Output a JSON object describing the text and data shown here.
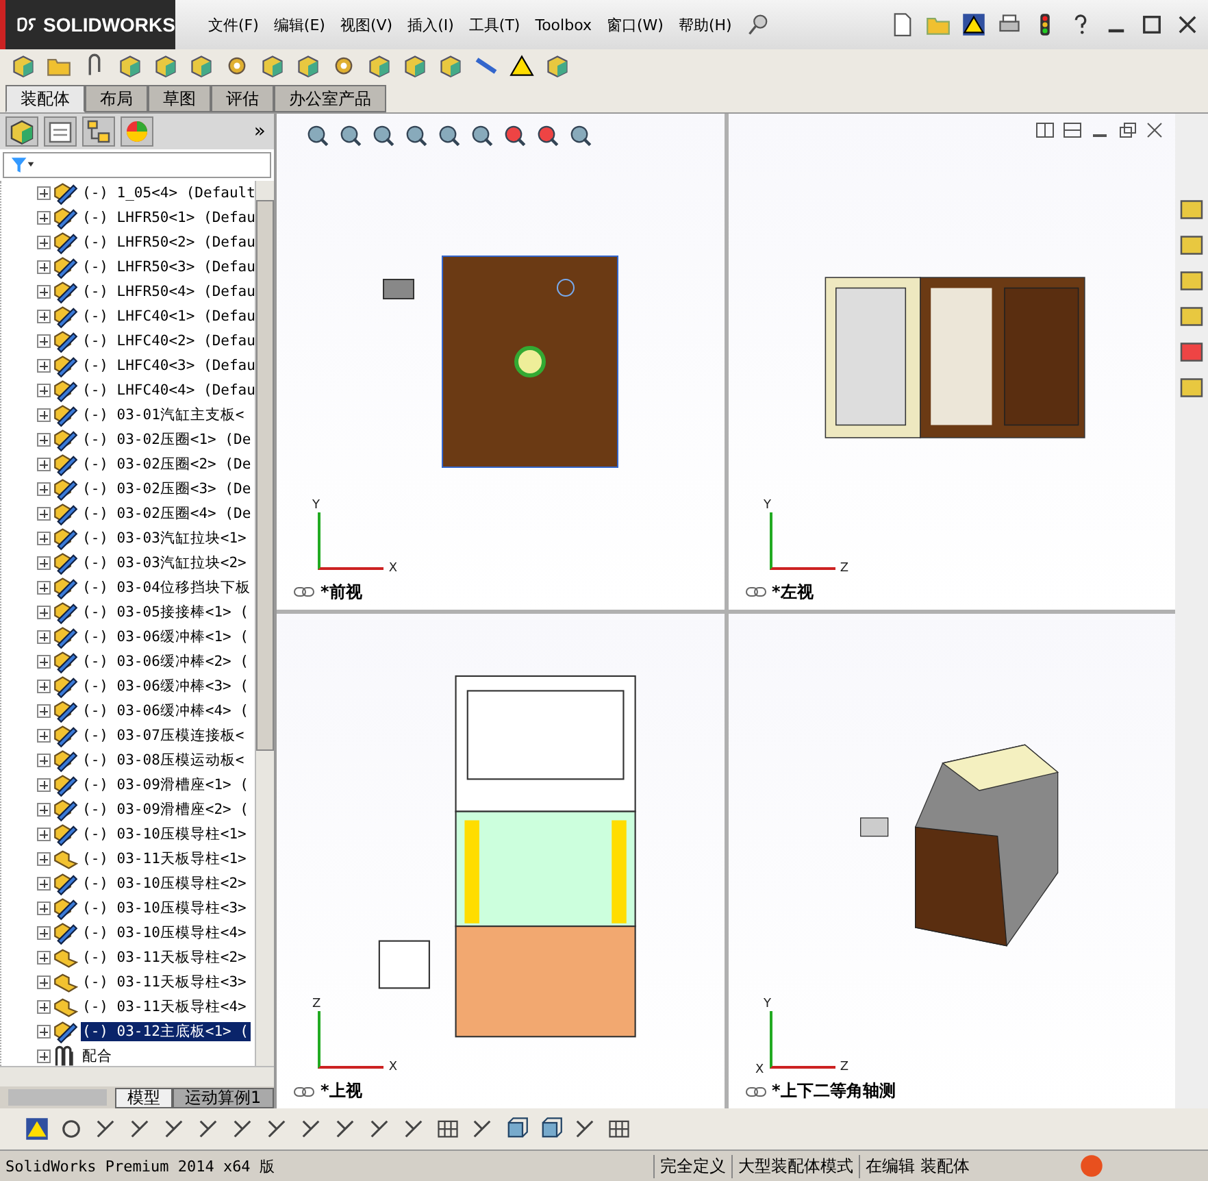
{
  "title_bar": {
    "logo": "SOLIDWORKS",
    "menu": [
      "文件(F)",
      "编辑(E)",
      "视图(V)",
      "插入(I)",
      "工具(T)",
      "Toolbox",
      "窗口(W)",
      "帮助(H)"
    ]
  },
  "command_tabs": [
    {
      "label": "装配体",
      "selected": true
    },
    {
      "label": "布局",
      "selected": false
    },
    {
      "label": "草图",
      "selected": false
    },
    {
      "label": "评估",
      "selected": false
    },
    {
      "label": "办公室产品",
      "selected": false
    }
  ],
  "panel": {
    "more": "»"
  },
  "tree": {
    "items": [
      {
        "kind": "part",
        "label": "(-) 1_05<4> (Default",
        "selected": false
      },
      {
        "kind": "part",
        "label": "(-) LHFR50<1> (Defau",
        "selected": false
      },
      {
        "kind": "part",
        "label": "(-) LHFR50<2> (Defau",
        "selected": false
      },
      {
        "kind": "part",
        "label": "(-) LHFR50<3> (Defau",
        "selected": false
      },
      {
        "kind": "part",
        "label": "(-) LHFR50<4> (Defau",
        "selected": false
      },
      {
        "kind": "part",
        "label": "(-) LHFC40<1> (Defau",
        "selected": false
      },
      {
        "kind": "part",
        "label": "(-) LHFC40<2> (Defau",
        "selected": false
      },
      {
        "kind": "part",
        "label": "(-) LHFC40<3> (Defau",
        "selected": false
      },
      {
        "kind": "part",
        "label": "(-) LHFC40<4> (Defau",
        "selected": false
      },
      {
        "kind": "part",
        "label": "(-) 03-01汽缸主支板<",
        "selected": false
      },
      {
        "kind": "part",
        "label": "(-) 03-02压圈<1> (De",
        "selected": false
      },
      {
        "kind": "part",
        "label": "(-) 03-02压圈<2> (De",
        "selected": false
      },
      {
        "kind": "part",
        "label": "(-) 03-02压圈<3> (De",
        "selected": false
      },
      {
        "kind": "part",
        "label": "(-) 03-02压圈<4> (De",
        "selected": false
      },
      {
        "kind": "part",
        "label": "(-) 03-03汽缸拉块<1>",
        "selected": false
      },
      {
        "kind": "part",
        "label": "(-) 03-03汽缸拉块<2>",
        "selected": false
      },
      {
        "kind": "part",
        "label": "(-) 03-04位移挡块下板",
        "selected": false
      },
      {
        "kind": "part",
        "label": "(-) 03-05接接棒<1> (",
        "selected": false
      },
      {
        "kind": "part",
        "label": "(-) 03-06缓冲棒<1> (",
        "selected": false
      },
      {
        "kind": "part",
        "label": "(-) 03-06缓冲棒<2> (",
        "selected": false
      },
      {
        "kind": "part",
        "label": "(-) 03-06缓冲棒<3> (",
        "selected": false
      },
      {
        "kind": "part",
        "label": "(-) 03-06缓冲棒<4> (",
        "selected": false
      },
      {
        "kind": "part",
        "label": "(-) 03-07压模连接板<",
        "selected": false
      },
      {
        "kind": "part",
        "label": "(-) 03-08压模运动板<",
        "selected": false
      },
      {
        "kind": "part",
        "label": "(-) 03-09滑槽座<1> (",
        "selected": false
      },
      {
        "kind": "part",
        "label": "(-) 03-09滑槽座<2> (",
        "selected": false
      },
      {
        "kind": "part",
        "label": "(-) 03-10压模导柱<1>",
        "selected": false
      },
      {
        "kind": "subassembly",
        "label": "(-) 03-11天板导柱<1>",
        "selected": false
      },
      {
        "kind": "part",
        "label": "(-) 03-10压模导柱<2>",
        "selected": false
      },
      {
        "kind": "part",
        "label": "(-) 03-10压模导柱<3>",
        "selected": false
      },
      {
        "kind": "part",
        "label": "(-) 03-10压模导柱<4>",
        "selected": false
      },
      {
        "kind": "subassembly",
        "label": "(-) 03-11天板导柱<2>",
        "selected": false
      },
      {
        "kind": "subassembly",
        "label": "(-) 03-11天板导柱<3>",
        "selected": false
      },
      {
        "kind": "subassembly",
        "label": "(-) 03-11天板导柱<4>",
        "selected": false
      },
      {
        "kind": "part",
        "label": "(-) 03-12主底板<1> (",
        "selected": true
      },
      {
        "kind": "mates",
        "label": "配合",
        "selected": false
      }
    ]
  },
  "bottom_tabs": [
    {
      "label": "模型",
      "selected": true
    },
    {
      "label": "运动算例1",
      "selected": false
    }
  ],
  "viewports": [
    {
      "kind": "front",
      "label": "*前视",
      "axes": [
        "Y",
        "X"
      ]
    },
    {
      "kind": "left",
      "label": "*左视",
      "axes": [
        "Y",
        "Z"
      ]
    },
    {
      "kind": "top",
      "label": "*上视",
      "axes": [
        "Z",
        "X"
      ]
    },
    {
      "kind": "iso",
      "label": "*上下二等角轴测",
      "axes": [
        "Y",
        "X",
        "Z"
      ]
    }
  ],
  "status_bar": {
    "edition": "SolidWorks Premium 2014 x64 版",
    "fields": [
      "完全定义",
      "大型装配体模式",
      "在编辑 装配体"
    ]
  }
}
